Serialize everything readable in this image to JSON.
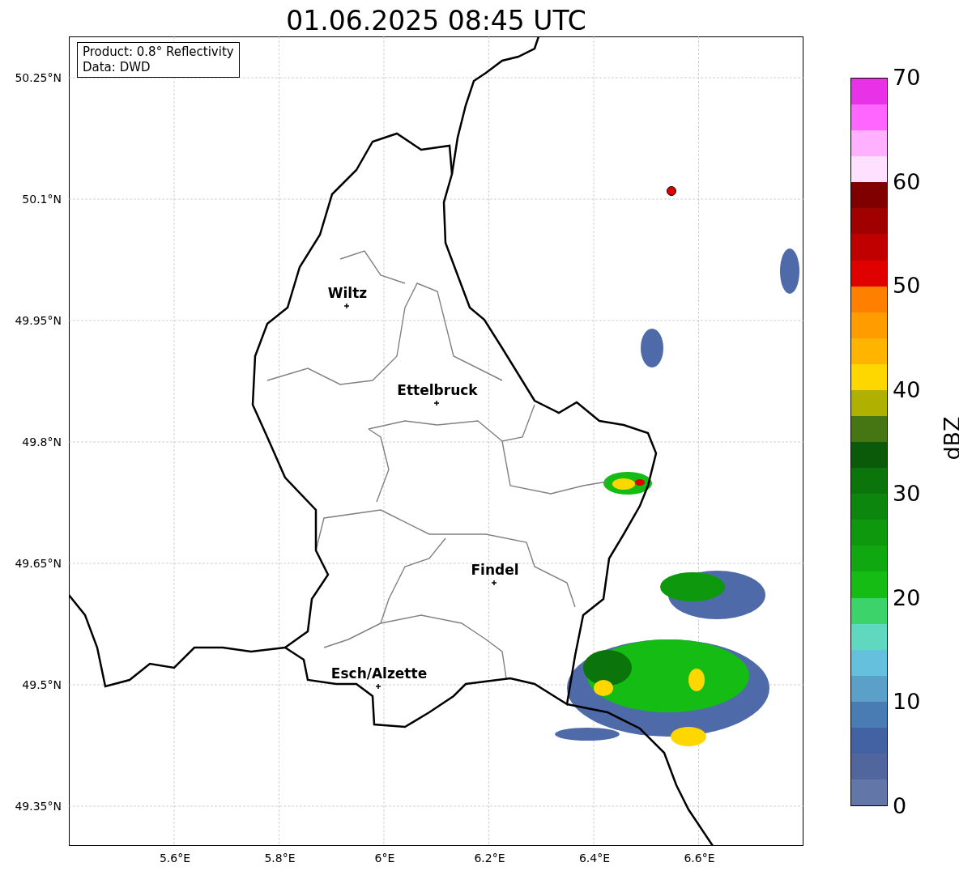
{
  "title": "01.06.2025 08:45 UTC",
  "legend": [
    "Product: 0.8° Reflectivity",
    "Data: DWD"
  ],
  "yticks": [
    "50.25°N",
    "50.1°N",
    "49.95°N",
    "49.8°N",
    "49.65°N",
    "49.5°N",
    "49.35°N"
  ],
  "xticks": [
    "5.6°E",
    "5.8°E",
    "6°E",
    "6.2°E",
    "6.4°E",
    "6.6°E"
  ],
  "cities": [
    {
      "label": "Wiltz"
    },
    {
      "label": "Ettelbruck"
    },
    {
      "label": "Findel"
    },
    {
      "label": "Esch/Alzette"
    }
  ],
  "colorbar": {
    "label": "dBZ",
    "ticks": [
      "70",
      "60",
      "50",
      "40",
      "30",
      "20",
      "10",
      "0"
    ],
    "bins": [
      {
        "color": "#e832e8"
      },
      {
        "color": "#ff66ff"
      },
      {
        "color": "#ffb0ff"
      },
      {
        "color": "#ffe0ff"
      },
      {
        "color": "#800000"
      },
      {
        "color": "#a00000"
      },
      {
        "color": "#c00000"
      },
      {
        "color": "#e00000"
      },
      {
        "color": "#ff8000"
      },
      {
        "color": "#ff9c00"
      },
      {
        "color": "#ffb400"
      },
      {
        "color": "#ffd700"
      },
      {
        "color": "#b0b000"
      },
      {
        "color": "#467514"
      },
      {
        "color": "#0a5a0a"
      },
      {
        "color": "#0b740b"
      },
      {
        "color": "#0c860c"
      },
      {
        "color": "#0e980e"
      },
      {
        "color": "#10a810"
      },
      {
        "color": "#14bc14"
      },
      {
        "color": "#3cd46a"
      },
      {
        "color": "#60d8c0"
      },
      {
        "color": "#64c0dc"
      },
      {
        "color": "#5aa0c8"
      },
      {
        "color": "#4a7cb4"
      },
      {
        "color": "#4262a4"
      },
      {
        "color": "#50669c"
      },
      {
        "color": "#6276a8"
      }
    ]
  }
}
